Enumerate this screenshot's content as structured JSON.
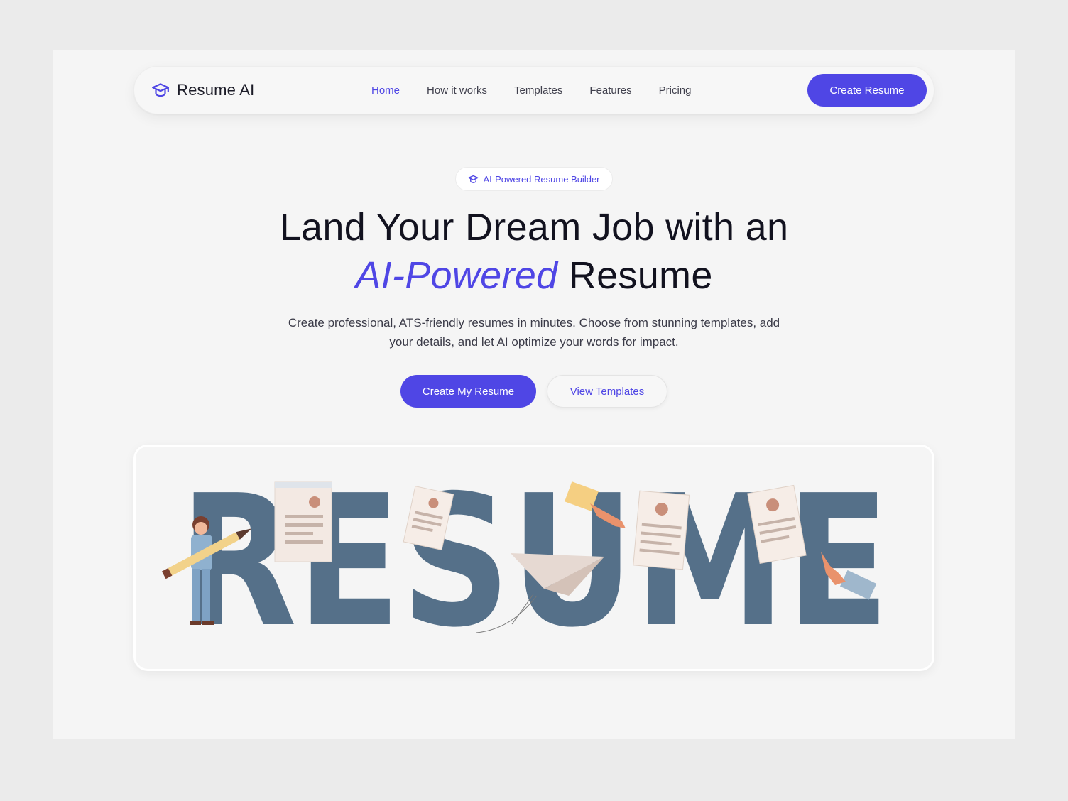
{
  "nav": {
    "logo_text": "Resume AI",
    "logo_icon": "graduation-cap-icon",
    "links": [
      "Home",
      "How it works",
      "Templates",
      "Features",
      "Pricing"
    ],
    "active_link": "Home",
    "cta_label": "Create Resume"
  },
  "hero": {
    "badge_text": "AI-Powered Resume Builder",
    "badge_icon": "graduation-cap-icon",
    "title_line1": "Land Your Dream Job with an",
    "title_accent": "AI-Powered",
    "title_rest": "Resume",
    "subtitle": "Create professional, ATS-friendly resumes in minutes. Choose from stunning templates, add your details, and let AI optimize your words for impact.",
    "primary_button": "Create My Resume",
    "secondary_button": "View Templates"
  },
  "illustration": {
    "word": "RESUME"
  },
  "colors": {
    "accent": "#4f46e5",
    "letters": "#557089",
    "background": "#f5f5f5"
  }
}
